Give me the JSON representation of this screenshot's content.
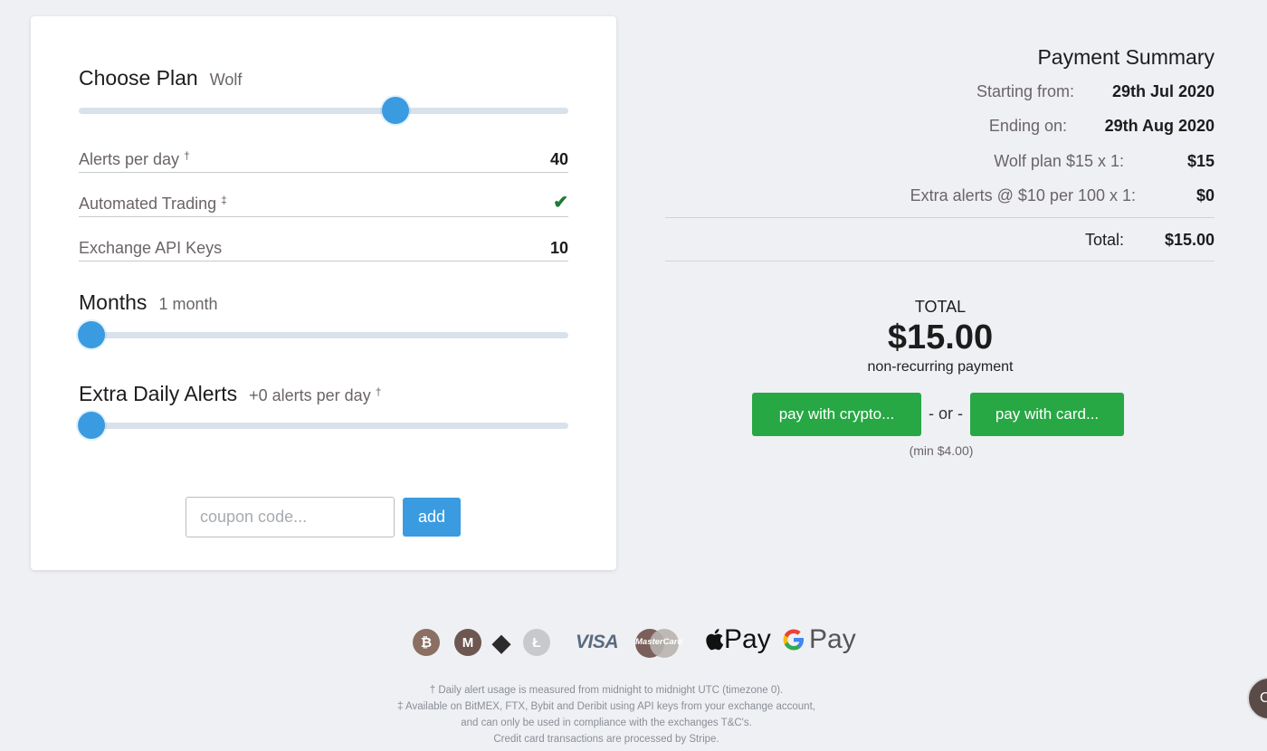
{
  "plan": {
    "title": "Choose Plan",
    "value": "Wolf",
    "slider_level": 0.655
  },
  "features": [
    {
      "label": "Alerts per day",
      "mark": "†",
      "value": "40"
    },
    {
      "label": "Automated Trading",
      "mark": "‡",
      "value": "✔"
    },
    {
      "label": "Exchange API Keys",
      "mark": "",
      "value": "10"
    }
  ],
  "months": {
    "title": "Months",
    "value": "1 month",
    "slider_level": 0
  },
  "extra_alerts": {
    "title": "Extra Daily Alerts",
    "value": "+0 alerts per day",
    "mark": "†",
    "slider_level": 0
  },
  "coupon": {
    "placeholder": "coupon code...",
    "add_label": "add"
  },
  "summary": {
    "title": "Payment Summary",
    "rows": [
      {
        "key": "Starting from:",
        "value": "29th Jul 2020"
      },
      {
        "key": "Ending on:",
        "value": "29th Aug 2020"
      },
      {
        "key": "Wolf plan $15 x 1:",
        "value": "$15"
      },
      {
        "key": "Extra alerts @ $10 per 100 x 1:",
        "value": "$0"
      }
    ],
    "total_key": "Total:",
    "total_value": "$15.00"
  },
  "checkout": {
    "total_label": "TOTAL",
    "amount": "$15.00",
    "note": "non-recurring payment",
    "crypto_button": "pay with crypto...",
    "or_label": "- or -",
    "card_button": "pay with card...",
    "min_note": "(min $4.00)"
  },
  "payment_methods": {
    "coins": [
      {
        "icon": "bitcoin-icon",
        "glyph": "₿",
        "color": "#8b6f62"
      },
      {
        "icon": "monero-icon",
        "glyph": "M",
        "color": "#6e5751"
      },
      {
        "icon": "ethereum-icon",
        "glyph": "◆",
        "color": "#3a3a3a"
      },
      {
        "icon": "litecoin-icon",
        "glyph": "Ł",
        "color": "#c7c9cc"
      }
    ],
    "visa": "VISA",
    "mastercard": "MasterCard",
    "apple_pay": "Pay",
    "google_pay": "Pay"
  },
  "footnotes": [
    "† Daily alert usage is measured from midnight to midnight UTC (timezone 0).",
    "‡ Available on BitMEX, FTX, Bybit and Deribit using API keys from your exchange account,",
    "and can only be used in compliance with the exchanges T&C's.",
    "Credit card transactions are processed by Stripe."
  ],
  "chat": {
    "label": "C"
  }
}
